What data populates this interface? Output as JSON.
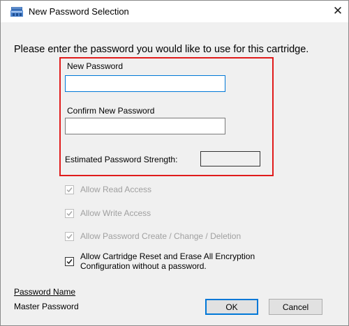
{
  "window": {
    "title": "New Password Selection",
    "close_glyph": "✕"
  },
  "prompt": "Please enter the password you would like to use for this cartridge.",
  "form": {
    "new_password_label": "New Password",
    "new_password_value": "",
    "confirm_password_label": "Confirm New Password",
    "confirm_password_value": "",
    "strength_label": "Estimated Password Strength:",
    "strength_value": ""
  },
  "options": [
    {
      "label": "Allow Read Access",
      "checked": true,
      "enabled": false
    },
    {
      "label": "Allow Write Access",
      "checked": true,
      "enabled": false
    },
    {
      "label": "Allow Password Create / Change / Deletion",
      "checked": true,
      "enabled": false
    },
    {
      "label_line1": "Allow Cartridge Reset and Erase All Encryption",
      "label_line2": "Configuration without a password.",
      "checked": true,
      "enabled": true
    }
  ],
  "password_name": {
    "heading": "Password Name",
    "value": "Master Password"
  },
  "buttons": {
    "ok": "OK",
    "cancel": "Cancel"
  },
  "colors": {
    "highlight": "#e01b1b",
    "focus": "#0078d7",
    "disabled_text": "#a0a0a0"
  },
  "icons": {
    "app": "cartridge-icon",
    "close": "close-icon",
    "check": "checkmark-icon"
  }
}
